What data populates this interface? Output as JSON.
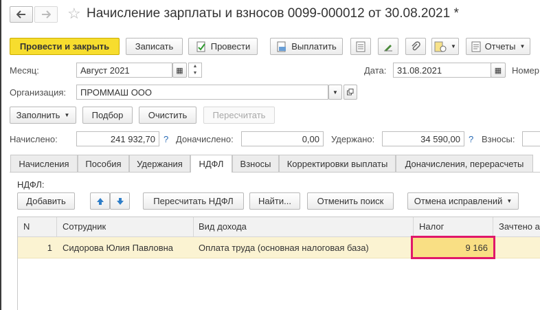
{
  "window": {
    "title": "Начисление зарплаты и взносов 0099-000012 от 30.08.2021 *"
  },
  "toolbar": {
    "post_close": "Провести и закрыть",
    "save": "Записать",
    "post": "Провести",
    "pay": "Выплатить",
    "reports": "Отчеты"
  },
  "header": {
    "month_label": "Месяц:",
    "month_value": "Август 2021",
    "date_label": "Дата:",
    "date_value": "31.08.2021",
    "number_label": "Номер",
    "org_label": "Организация:",
    "org_value": "ПРОММАШ ООО"
  },
  "actions": {
    "fill": "Заполнить",
    "pick": "Подбор",
    "clear": "Очистить",
    "recalc": "Пересчитать"
  },
  "totals": {
    "accrued_label": "Начислено:",
    "accrued_value": "241 932,70",
    "additional_label": "Доначислено:",
    "additional_value": "0,00",
    "withheld_label": "Удержано:",
    "withheld_value": "34 590,00",
    "contrib_label": "Взносы:",
    "help": "?"
  },
  "tabs": [
    "Начисления",
    "Пособия",
    "Удержания",
    "НДФЛ",
    "Взносы",
    "Корректировки выплаты",
    "Доначисления, перерасчеты"
  ],
  "ndfl": {
    "section_label": "НДФЛ:",
    "add": "Добавить",
    "recalc_ndfl": "Пересчитать НДФЛ",
    "find": "Найти...",
    "cancel_search": "Отменить поиск",
    "cancel_fixes": "Отмена исправлений"
  },
  "table": {
    "columns": [
      "N",
      "Сотрудник",
      "Вид дохода",
      "Налог",
      "Зачтено а"
    ],
    "rows": [
      {
        "n": "1",
        "employee": "Сидорова Юлия Павловна",
        "income_type": "Оплата труда (основная налоговая база)",
        "tax": "9 166"
      }
    ]
  },
  "colors": {
    "primary_button": "#f7dd2e",
    "selected_row": "#fbf3d2",
    "highlight_cell": "#f9df84",
    "highlight_border": "#e0176a"
  }
}
